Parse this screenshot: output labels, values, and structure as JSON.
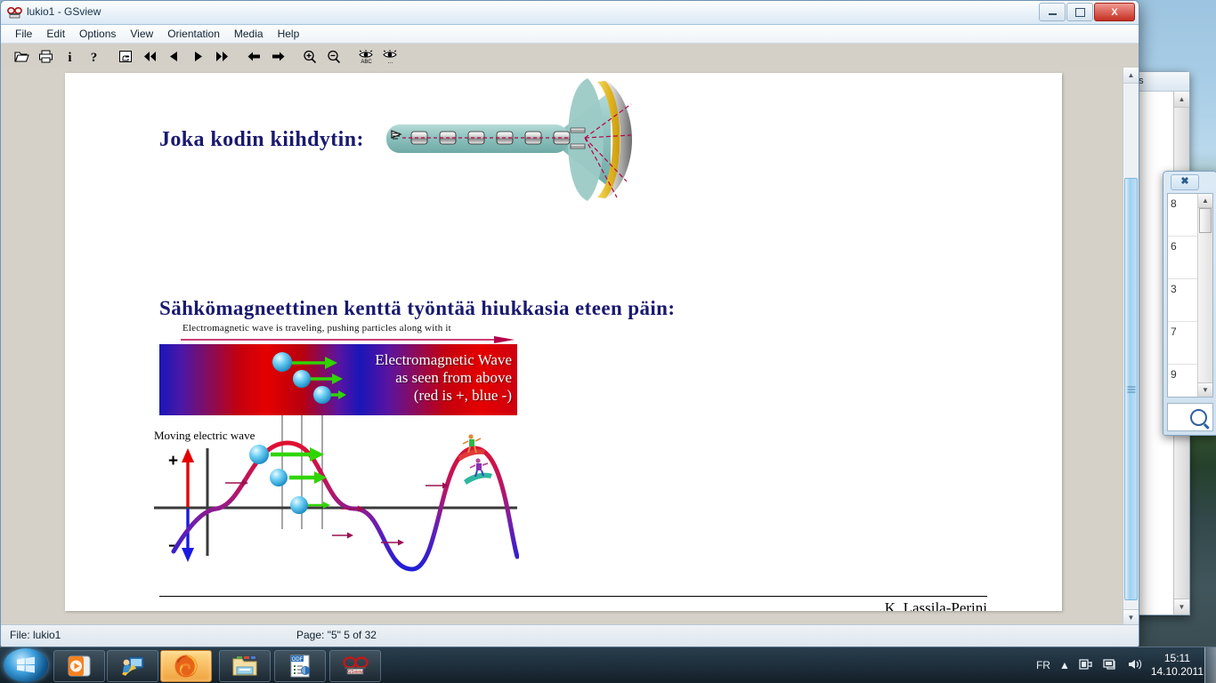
{
  "window": {
    "title": "lukio1 - GSview",
    "icon": "gsview-glasses-icon",
    "minimize_label": "Minimize",
    "maximize_label": "Maximize",
    "close_label": "X"
  },
  "menu": {
    "items": [
      {
        "label": "File"
      },
      {
        "label": "Edit"
      },
      {
        "label": "Options"
      },
      {
        "label": "View"
      },
      {
        "label": "Orientation"
      },
      {
        "label": "Media"
      },
      {
        "label": "Help"
      }
    ]
  },
  "toolbar": {
    "buttons": [
      {
        "name": "open-file-icon",
        "glyph": "open"
      },
      {
        "name": "print-icon",
        "glyph": "print"
      },
      {
        "name": "info-icon",
        "glyph": "i"
      },
      {
        "name": "help-icon",
        "glyph": "?"
      },
      {
        "name": "select-hand-icon",
        "glyph": "hand"
      },
      {
        "name": "first-page-icon",
        "glyph": "rewind"
      },
      {
        "name": "previous-page-icon",
        "glyph": "prev"
      },
      {
        "name": "next-page-icon",
        "glyph": "next"
      },
      {
        "name": "last-page-icon",
        "glyph": "forward"
      },
      {
        "name": "scroll-left-icon",
        "glyph": "left"
      },
      {
        "name": "scroll-right-icon",
        "glyph": "right"
      },
      {
        "name": "zoom-in-icon",
        "glyph": "zoomin"
      },
      {
        "name": "zoom-out-icon",
        "glyph": "zoomout"
      },
      {
        "name": "show-text-icon",
        "glyph": "eye-abc"
      },
      {
        "name": "show-dots-icon",
        "glyph": "eye-dots"
      }
    ]
  },
  "statusbar": {
    "file_label": "File: lukio1",
    "page_label": "Page: \"5\"  5 of 32"
  },
  "slide": {
    "heading1": "Joka kodin kiihdytin:",
    "heading2": "Sähkömagneettinen kenttä työntää hiukkasia eteen päin:",
    "wave_caption": "Electromagnetic wave is traveling, pushing particles along with it",
    "band_text_line1": "Electromagnetic Wave",
    "band_text_line2": "as seen from above",
    "band_text_line3": "(red is +, blue -)",
    "wave_label": "Moving electric wave",
    "plus_sign": "+",
    "minus_sign": "-",
    "footer_author": "K. Lassila-Perini"
  },
  "colors": {
    "heading": "#191970",
    "caption_arrow": "#b5004a",
    "band_red": "#e40000",
    "band_blue": "#1a15b8",
    "particle": "#4fc3f7",
    "green_arrow": "#2fd500",
    "plus_arrow": "#e40000",
    "minus_arrow": "#1a1ae0",
    "crt_body": "#8fc4c0",
    "crt_screen": "#e8c53a",
    "beam": "#b5004a"
  },
  "background_windows": {
    "browser": {
      "bookmarks_label": "rks"
    },
    "dialog": {
      "close_label": "✖",
      "rows": [
        "8",
        "6",
        "3",
        "7",
        "9"
      ],
      "search_icon": "magnifier-icon"
    }
  },
  "taskbar": {
    "start_label": "Start",
    "apps": [
      {
        "name": "taskbar-media-player",
        "label": "Windows Media Player"
      },
      {
        "name": "taskbar-desktop-tool",
        "label": "Desktop Tool"
      },
      {
        "name": "taskbar-firefox",
        "label": "Mozilla Firefox"
      },
      {
        "name": "taskbar-explorer",
        "label": "Windows Explorer"
      },
      {
        "name": "taskbar-impress",
        "label": "ODF Presentation"
      },
      {
        "name": "taskbar-gsview",
        "label": "GSview"
      }
    ],
    "tray": {
      "language": "FR",
      "show_hidden_label": "Show hidden icons",
      "power_icon": "power-plug-icon",
      "network_icon": "network-icon",
      "volume_icon": "volume-icon",
      "time": "15:11",
      "date": "14.10.2011"
    }
  }
}
